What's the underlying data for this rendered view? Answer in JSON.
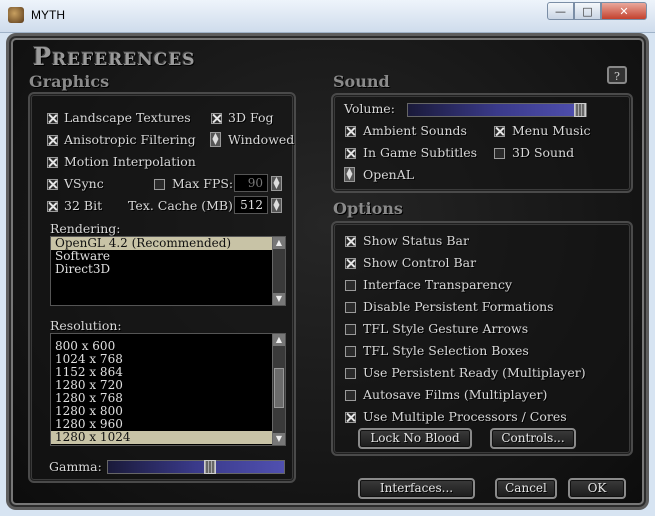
{
  "window": {
    "title": "MYTH",
    "min": "—",
    "max": "□",
    "close": "✕"
  },
  "dialog": {
    "title": "Preferences",
    "help": "?"
  },
  "graphics": {
    "title": "Graphics",
    "landscape_textures": {
      "label": "Landscape Textures",
      "checked": true
    },
    "fog_3d": {
      "label": "3D Fog",
      "checked": true
    },
    "aniso": {
      "label": "Anisotropic Filtering",
      "checked": true
    },
    "windowed": {
      "label": "Windowed"
    },
    "motion_interp": {
      "label": "Motion Interpolation",
      "checked": true
    },
    "vsync": {
      "label": "VSync",
      "checked": true
    },
    "max_fps": {
      "label": "Max FPS:",
      "checked": false,
      "value": "90"
    },
    "bit32": {
      "label": "32 Bit",
      "checked": true
    },
    "tex_cache": {
      "label": "Tex. Cache (MB):",
      "value": "512"
    },
    "rendering": {
      "label": "Rendering:",
      "items": [
        {
          "text": "OpenGL 4.2  (Recommended)",
          "selected": true
        },
        {
          "text": "Software",
          "selected": false
        },
        {
          "text": "Direct3D",
          "selected": false
        }
      ]
    },
    "resolution": {
      "label": "Resolution:",
      "items": [
        {
          "text": "800 x 600",
          "selected": false
        },
        {
          "text": "1024 x 768",
          "selected": false
        },
        {
          "text": "1152 x 864",
          "selected": false
        },
        {
          "text": "1280 x 720",
          "selected": false
        },
        {
          "text": "1280 x 768",
          "selected": false
        },
        {
          "text": "1280 x 800",
          "selected": false
        },
        {
          "text": "1280 x 960",
          "selected": false
        },
        {
          "text": "1280 x 1024",
          "selected": true
        }
      ]
    },
    "gamma": {
      "label": "Gamma:",
      "level": 0.58
    }
  },
  "sound": {
    "title": "Sound",
    "volume": {
      "label": "Volume:",
      "level": 1.0
    },
    "ambient": {
      "label": "Ambient Sounds",
      "checked": true
    },
    "menu_music": {
      "label": "Menu Music",
      "checked": true
    },
    "subtitles": {
      "label": "In Game Subtitles",
      "checked": true
    },
    "sound3d": {
      "label": "3D Sound",
      "checked": false
    },
    "openal": {
      "label": "OpenAL"
    }
  },
  "options": {
    "title": "Options",
    "items": [
      {
        "label": "Show Status Bar",
        "checked": true
      },
      {
        "label": "Show Control Bar",
        "checked": true
      },
      {
        "label": "Interface Transparency",
        "checked": false
      },
      {
        "label": "Disable Persistent Formations",
        "checked": false
      },
      {
        "label": "TFL Style Gesture Arrows",
        "checked": false
      },
      {
        "label": "TFL Style Selection Boxes",
        "checked": false
      },
      {
        "label": "Use Persistent Ready (Multiplayer)",
        "checked": false
      },
      {
        "label": "Autosave Films (Multiplayer)",
        "checked": false
      },
      {
        "label": "Use Multiple Processors / Cores",
        "checked": true
      }
    ],
    "lock_no_blood": "Lock No Blood",
    "controls": "Controls..."
  },
  "footer": {
    "interfaces": "Interfaces...",
    "cancel": "Cancel",
    "ok": "OK"
  }
}
